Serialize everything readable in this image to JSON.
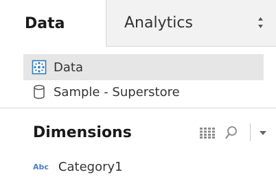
{
  "tabs": [
    {
      "label": "Data",
      "active": true
    },
    {
      "label": "Analytics",
      "active": false
    }
  ],
  "datasources": [
    {
      "label": "Data",
      "icon": "database-grid-icon",
      "selected": true
    },
    {
      "label": "Sample - Superstore",
      "icon": "database-cylinder-icon",
      "selected": false
    }
  ],
  "dimensions": {
    "title": "Dimensions",
    "tools": [
      "grid-view-icon",
      "search-icon",
      "dropdown-arrow-icon"
    ],
    "fields": [
      {
        "type_badge": "Abc",
        "name": "Category1"
      }
    ]
  },
  "colors": {
    "selected_bg": "#e6e6e6",
    "inactive_tab_bg": "#f2f2f2",
    "abc_badge": "#4a7fc1",
    "datasource_icon": "#2f7bbd"
  }
}
